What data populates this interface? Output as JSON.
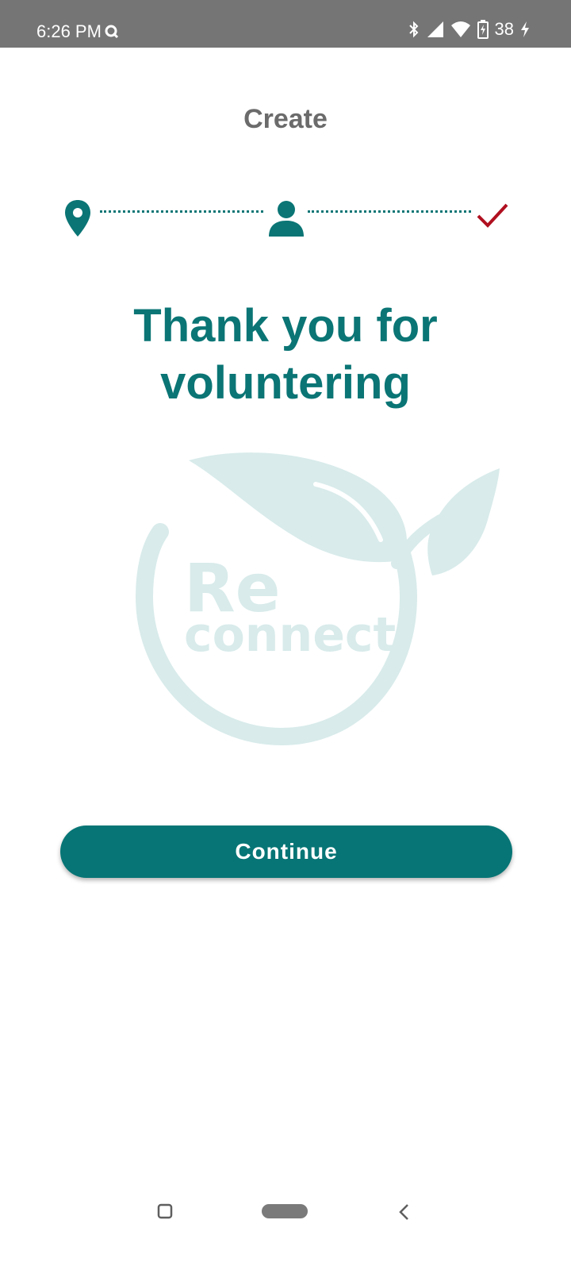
{
  "status_bar": {
    "time": "6:26 PM",
    "battery": "38"
  },
  "header": {
    "title": "Create"
  },
  "stepper": {
    "steps": [
      {
        "icon": "location-pin-icon",
        "state": "done"
      },
      {
        "icon": "person-icon",
        "state": "done"
      },
      {
        "icon": "checkmark-icon",
        "state": "current"
      }
    ]
  },
  "main": {
    "headline_line1": "Thank you for",
    "headline_line2": "voluntering",
    "logo_text_line1": "Re",
    "logo_text_line2": "connect"
  },
  "actions": {
    "continue_label": "Continue"
  },
  "colors": {
    "primary": "#077575",
    "check": "#b01020",
    "logo_tint": "#d9ebeb"
  }
}
